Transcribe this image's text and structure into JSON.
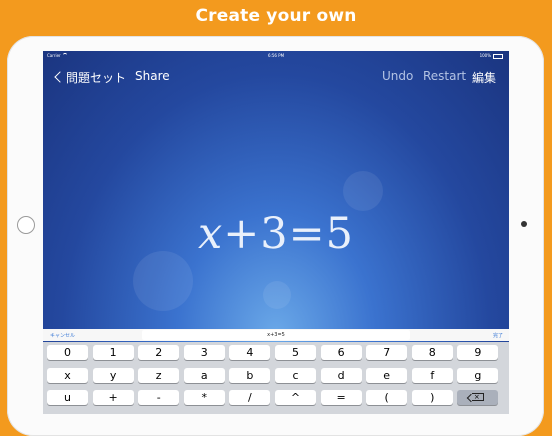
{
  "banner": {
    "title": "Create your own"
  },
  "status": {
    "carrier": "Carrier",
    "time": "6:56 PM",
    "battery": "100%"
  },
  "toolbar": {
    "back_label": "問題セット",
    "share_label": "Share",
    "undo_label": "Undo",
    "restart_label": "Restart",
    "edit_label": "編集"
  },
  "equation": {
    "variable": "x",
    "rest": "+3=5"
  },
  "input_bar": {
    "cancel_label": "キャンセル",
    "value": "x+3=5",
    "done_label": "完了"
  },
  "keyboard": {
    "rows": [
      [
        "0",
        "1",
        "2",
        "3",
        "4",
        "5",
        "6",
        "7",
        "8",
        "9"
      ],
      [
        "x",
        "y",
        "z",
        "a",
        "b",
        "c",
        "d",
        "e",
        "f",
        "g"
      ],
      [
        "u",
        "+",
        "-",
        "*",
        "/",
        "^",
        "=",
        "(",
        ")",
        "backspace"
      ]
    ]
  },
  "colors": {
    "background": "#F39A1E",
    "accent": "#3A79D6"
  }
}
